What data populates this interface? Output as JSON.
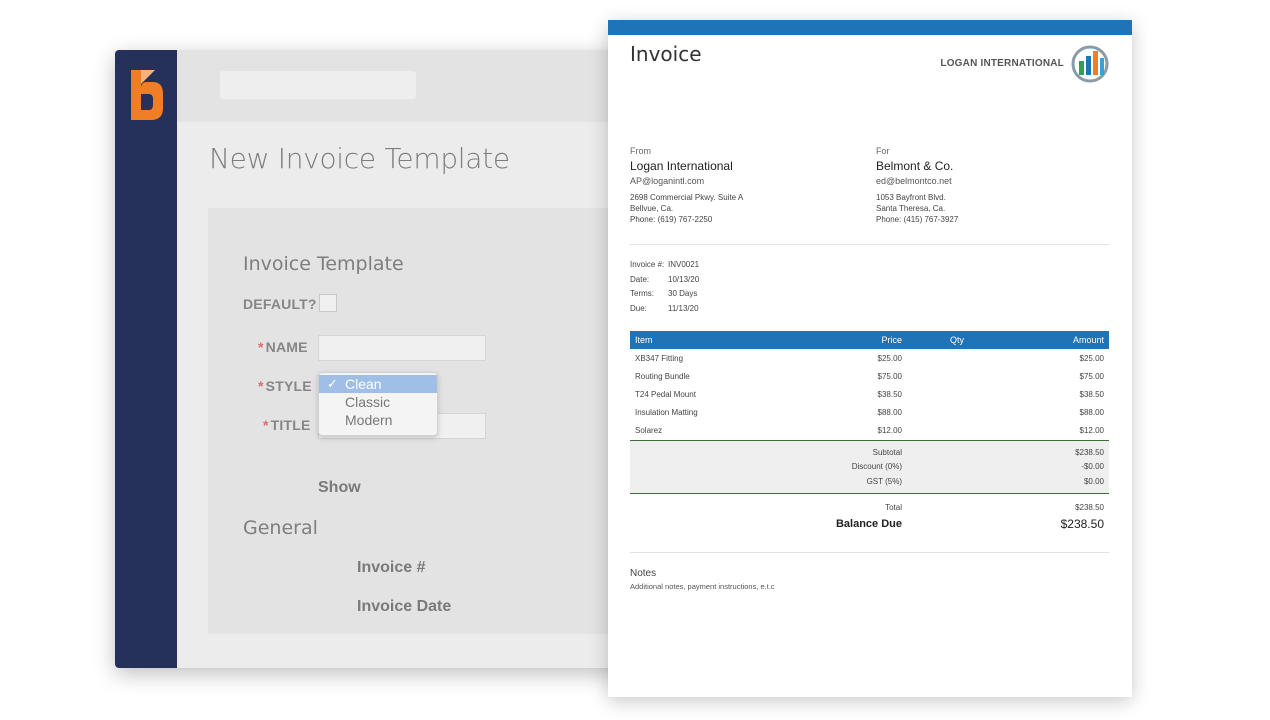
{
  "app": {
    "page_title": "New Invoice Template",
    "sections": {
      "template": "Invoice Template",
      "general": "General"
    },
    "fields": {
      "default_label": "DEFAULT?",
      "name_label": "NAME",
      "style_label": "STYLE",
      "title_label": "TITLE",
      "required_marker": "*"
    },
    "style_options": [
      {
        "label": "Clean",
        "selected": true,
        "check": "✓"
      },
      {
        "label": "Classic",
        "selected": false,
        "check": ""
      },
      {
        "label": "Modern",
        "selected": false,
        "check": ""
      }
    ],
    "show_label": "Show",
    "general_items": [
      "Invoice #",
      "Invoice Date"
    ],
    "colors": {
      "sidebar": "#25315a",
      "logo": "#f07e26"
    }
  },
  "invoice": {
    "title": "Invoice",
    "company_name": "LOGAN INTERNATIONAL",
    "from": {
      "label": "From",
      "name": "Logan International",
      "email": "AP@loganintl.com",
      "address1": "2698 Commercial Pkwy. Suite A",
      "address2": "Bellvue, Ca.",
      "phone": "Phone: (619) 767-2250"
    },
    "for": {
      "label": "For",
      "name": "Belmont & Co.",
      "email": "ed@belmontco.net",
      "address1": "1053 Bayfront Blvd.",
      "address2": "Santa Theresa, Ca.",
      "phone": "Phone: (415) 767-3927"
    },
    "meta": [
      {
        "key": "Invoice #:",
        "value": "INV0021"
      },
      {
        "key": "Date:",
        "value": "10/13/20"
      },
      {
        "key": "Terms:",
        "value": "30 Days"
      },
      {
        "key": "Due:",
        "value": "11/13/20"
      }
    ],
    "table_headers": {
      "item": "Item",
      "price": "Price",
      "qty": "Qty",
      "amount": "Amount"
    },
    "items": [
      {
        "item": "XB347 Fitting",
        "price": "$25.00",
        "qty": "",
        "amount": "$25.00"
      },
      {
        "item": "Routing Bundle",
        "price": "$75.00",
        "qty": "",
        "amount": "$75.00"
      },
      {
        "item": "T24 Pedal Mount",
        "price": "$38.50",
        "qty": "",
        "amount": "$38.50"
      },
      {
        "item": "Insulation Matting",
        "price": "$88.00",
        "qty": "",
        "amount": "$88.00"
      },
      {
        "item": "Solarez",
        "price": "$12.00",
        "qty": "",
        "amount": "$12.00"
      }
    ],
    "subtotal_rows": [
      {
        "key": "Subtotal",
        "value": "$238.50"
      },
      {
        "key": "Discount (0%)",
        "value": "-$0.00"
      },
      {
        "key": "GST (5%)",
        "value": "$0.00"
      }
    ],
    "total": {
      "key": "Total",
      "value": "$238.50"
    },
    "balance_due": {
      "key": "Balance Due",
      "value": "$238.50"
    },
    "notes": {
      "title": "Notes",
      "text": "Additional notes, payment instructions, e.t.c"
    },
    "colors": {
      "accent": "#1f73b7",
      "totals_rule": "#3d6b3a"
    }
  }
}
